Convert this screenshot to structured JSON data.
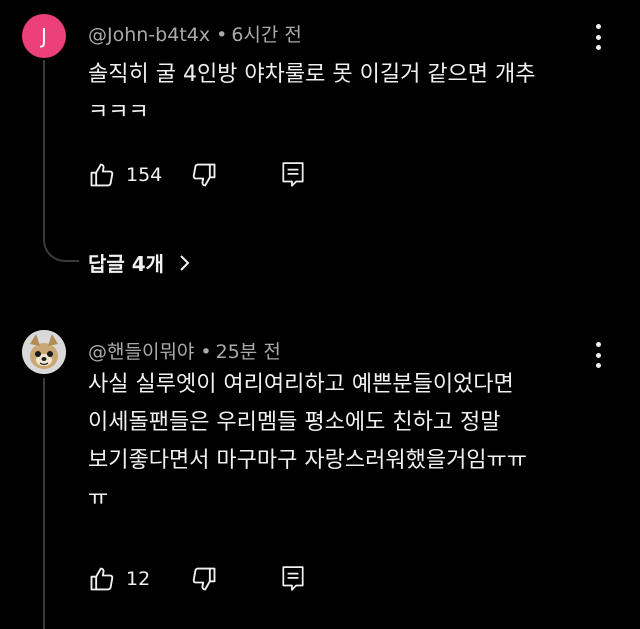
{
  "comments": [
    {
      "avatar_letter": "J",
      "avatar_color": "#ec407a",
      "author": "@John-b4t4x",
      "separator": "•",
      "time": "6시간 전",
      "text": "솔직히 굴 4인방 야차룰로 못 이길거 같으면 개추\nㅋㅋㅋ",
      "likes": "154",
      "replies_label": "답글 4개",
      "icons": [
        "like-icon",
        "dislike-icon",
        "reply-icon",
        "more-icon",
        "chevron-right-icon"
      ]
    },
    {
      "avatar_image": "dog-avatar",
      "author": "@핸들이뭐야",
      "separator": "•",
      "time": "25분 전",
      "text": "사실 실루엣이 여리여리하고 예쁜분들이었다면\n이세돌팬들은 우리멤들 평소에도 친하고 정말\n보기좋다면서 마구마구 자랑스러워했을거임ㅠㅠ\nㅠ",
      "likes": "12",
      "icons": [
        "like-icon",
        "dislike-icon",
        "reply-icon",
        "more-icon"
      ]
    }
  ]
}
